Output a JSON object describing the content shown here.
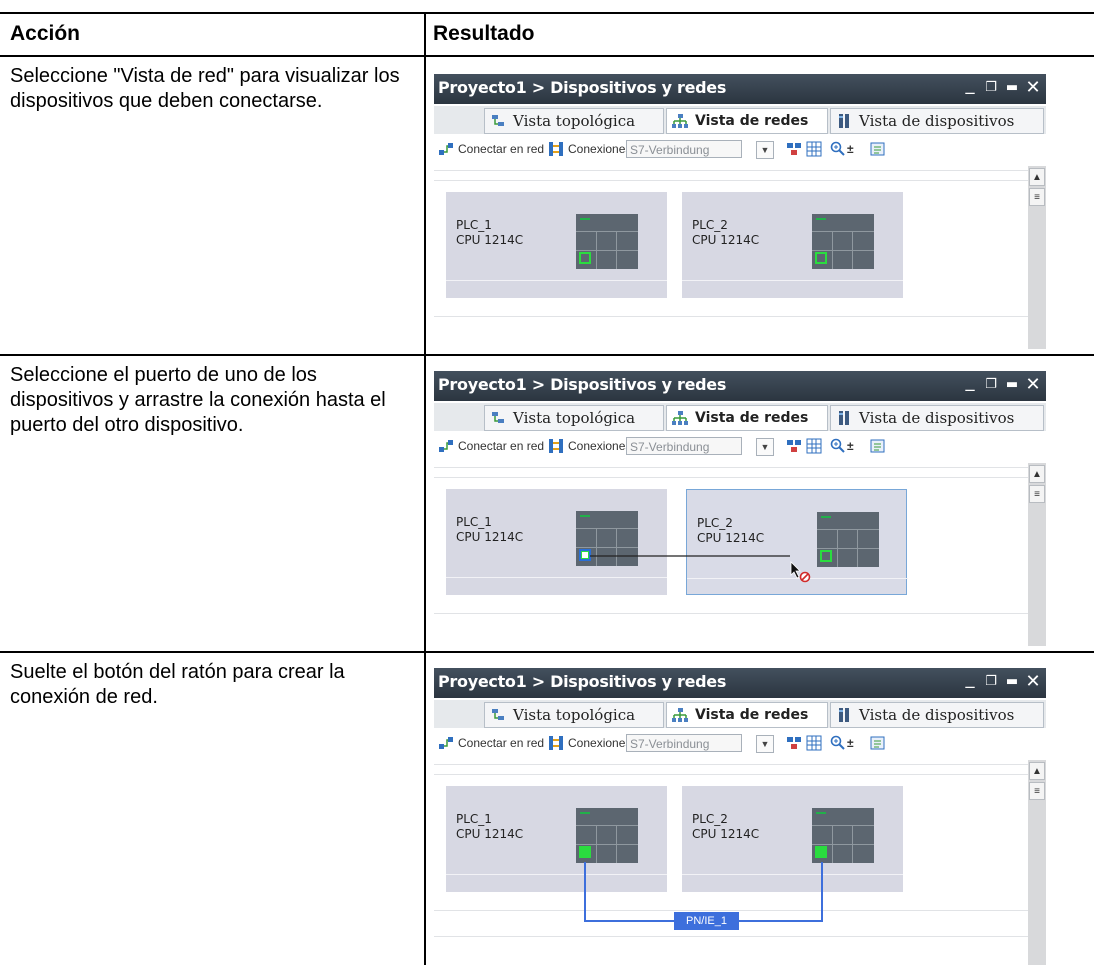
{
  "table": {
    "headers": {
      "action": "Acción",
      "result": "Resultado"
    },
    "rows": [
      {
        "action": "Seleccione \"Vista de red\" para visualizar los dispositivos que deben conectarse."
      },
      {
        "action": "Seleccione el puerto de uno de los dispositivos y arrastre la conexión hasta el puerto del otro dispositivo."
      },
      {
        "action": "Suelte el botón del ratón para crear la conexión de red."
      }
    ]
  },
  "window": {
    "title": "Proyecto1 > Dispositivos y redes",
    "controls": {
      "minimize": "_",
      "restore": "❐",
      "maximize": "▬",
      "close": "✕"
    },
    "tabs": [
      {
        "label": "Vista topológica",
        "icon": "topology-icon",
        "active": false
      },
      {
        "label": "Vista de redes",
        "icon": "network-icon",
        "active": true
      },
      {
        "label": "Vista de dispositivos",
        "icon": "device-icon",
        "active": false
      }
    ],
    "toolbar": {
      "connect_label": "Conectar en red",
      "connections_label": "Conexiones",
      "connection_type": "S7-Verbindung"
    },
    "scroll": {
      "up": "▲",
      "grip": "≡"
    },
    "devices": [
      {
        "name": "PLC_1",
        "type": "CPU 1214C"
      },
      {
        "name": "PLC_2",
        "type": "CPU 1214C"
      }
    ],
    "subnet_label": "PN/IE_1"
  },
  "colors": {
    "title_bar": "#2f3a45",
    "device_bg": "#d7d8e3",
    "port_green": "#2adc3f",
    "subnet_blue": "#3d6fdc"
  }
}
